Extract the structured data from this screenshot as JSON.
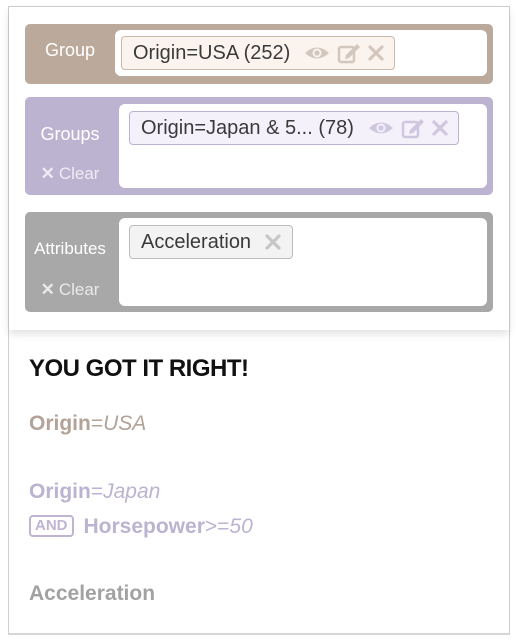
{
  "colors": {
    "group_row": "#bba99b",
    "group_pill_bg": "#fbf4ee",
    "group_pill_border": "#cbb9aa",
    "groups_row": "#bcb3d0",
    "groups_pill_bg": "#f4f1fa",
    "groups_pill_border": "#bdb2d4",
    "attributes_row": "#a8a8a8",
    "attributes_pill_bg": "#f3f3f3",
    "attributes_pill_border": "#bdbdbd",
    "result_title": "#111111",
    "result_group_text": "#b3a297",
    "result_groups_text": "#bcb3d0",
    "result_attr_text": "#a2a2a2"
  },
  "group_row": {
    "label": "Group",
    "pill": {
      "text": "Origin=USA (252)",
      "icons": [
        "eye-icon",
        "edit-icon",
        "close-icon"
      ]
    }
  },
  "groups_row": {
    "label": "Groups",
    "clear_label": "Clear",
    "pill": {
      "text": "Origin=Japan & 5... (78)",
      "icons": [
        "eye-icon",
        "edit-icon",
        "close-icon"
      ]
    }
  },
  "attributes_row": {
    "label": "Attributes",
    "clear_label": "Clear",
    "pill": {
      "text": "Acceleration",
      "icons": [
        "close-icon"
      ]
    }
  },
  "result": {
    "title": "YOU GOT IT RIGHT!",
    "group_attr": "Origin",
    "group_eq": "=",
    "group_val": "USA",
    "groups_attr": "Origin",
    "groups_eq": "=",
    "groups_val": "Japan",
    "and_label": "AND",
    "groups2_attr": "Horsepower",
    "groups2_eq": ">=",
    "groups2_val": "50",
    "attribute": "Acceleration"
  }
}
